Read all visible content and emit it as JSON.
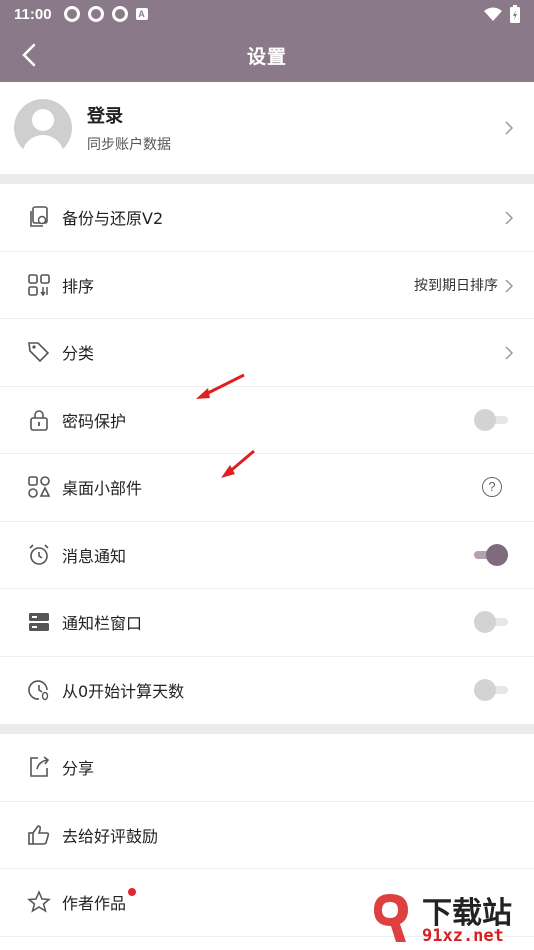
{
  "status": {
    "time": "11:00",
    "badge": "A"
  },
  "appbar": {
    "title": "设置"
  },
  "profile": {
    "name": "登录",
    "subtitle": "同步账户数据"
  },
  "group1": [
    {
      "key": "backup",
      "label": "备份与还原V2",
      "icon": "backup-icon"
    },
    {
      "key": "sort",
      "label": "排序",
      "value": "按到期日排序",
      "icon": "sort-grid-icon"
    },
    {
      "key": "category",
      "label": "分类",
      "icon": "tag-icon"
    },
    {
      "key": "password",
      "label": "密码保护",
      "icon": "lock-icon",
      "toggle": false
    },
    {
      "key": "widget",
      "label": "桌面小部件",
      "icon": "widget-shapes-icon"
    },
    {
      "key": "notify",
      "label": "消息通知",
      "icon": "alarm-clock-icon",
      "toggle": true
    },
    {
      "key": "statusbar",
      "label": "通知栏窗口",
      "icon": "server-icon",
      "toggle": false
    },
    {
      "key": "count",
      "label": "从0开始计算天数",
      "icon": "clock-zero-icon",
      "toggle": false
    }
  ],
  "group2": [
    {
      "key": "share",
      "label": "分享",
      "icon": "share-icon"
    },
    {
      "key": "rate",
      "label": "去给好评鼓励",
      "icon": "thumbs-up-icon"
    },
    {
      "key": "works",
      "label": "作者作品",
      "icon": "star-icon"
    }
  ],
  "help_glyph": "?",
  "watermark": {
    "brand": "下载站",
    "site": "91xz.net"
  },
  "colors": {
    "primary": "#8a7a89",
    "toggle_on": "#7f6b7e",
    "annotation": "#e02020",
    "badge": "#e8242a"
  }
}
